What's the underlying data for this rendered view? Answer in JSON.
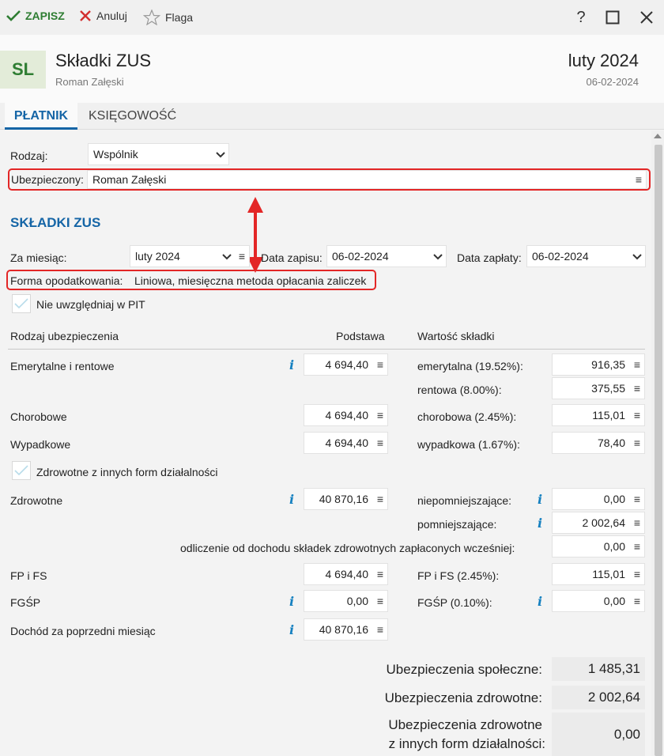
{
  "toolbar": {
    "save_label": "ZAPISZ",
    "cancel_label": "Anuluj",
    "flag_label": "Flaga",
    "help_glyph": "?",
    "maximize_glyph": "☐",
    "close_glyph": "✕"
  },
  "header": {
    "badge": "SL",
    "title": "Składki ZUS",
    "subtitle": "Roman Załęski",
    "period": "luty 2024",
    "period_date": "06-02-2024"
  },
  "tabs": {
    "active": "PŁATNIK",
    "inactive": "KSIĘGOWOŚĆ"
  },
  "payer": {
    "rodzaj_label": "Rodzaj:",
    "rodzaj_value": "Wspólnik",
    "ubezpieczony_label": "Ubezpieczony:",
    "ubezpieczony_value": "Roman Załęski"
  },
  "zus": {
    "section_title": "SKŁADKI ZUS",
    "za_miesiac_label": "Za miesiąc:",
    "za_miesiac_value": "luty 2024",
    "data_zapisu_label": "Data zapisu:",
    "data_zapisu_value": "06-02-2024",
    "data_zaplaty_label": "Data zapłaty:",
    "data_zaplaty_value": "06-02-2024",
    "forma_label": "Forma opodatkowania:",
    "forma_value": "Liniowa, miesięczna metoda opłacania zaliczek",
    "nie_uwzgledniaj_label": "Nie uwzględniaj w PIT",
    "col_rodzaj": "Rodzaj ubezpieczenia",
    "col_podstawa": "Podstawa",
    "col_wartosc": "Wartość składki"
  },
  "rows": {
    "emerytalne": {
      "label": "Emerytalne i rentowe",
      "podstawa": "4 694,40"
    },
    "emerytalna": {
      "label": "emerytalna (19.52%):",
      "value": "916,35"
    },
    "rentowa": {
      "label": "rentowa (8.00%):",
      "value": "375,55"
    },
    "chorobowe": {
      "label": "Chorobowe",
      "podstawa": "4 694,40"
    },
    "chorobowa": {
      "label": "chorobowa (2.45%):",
      "value": "115,01"
    },
    "wypadkowe": {
      "label": "Wypadkowe",
      "podstawa": "4 694,40"
    },
    "wypadkowa": {
      "label": "wypadkowa (1.67%):",
      "value": "78,40"
    },
    "zdrowotne_inne_label": "Zdrowotne z innych form działalności",
    "zdrowotne": {
      "label": "Zdrowotne",
      "podstawa": "40 870,16"
    },
    "niepomniejszajace": {
      "label": "niepomniejszające:",
      "value": "0,00"
    },
    "pomniejszajace": {
      "label": "pomniejszające:",
      "value": "2 002,64"
    },
    "odliczenie": {
      "label": "odliczenie od dochodu składek zdrowotnych zapłaconych wcześniej:",
      "value": "0,00"
    },
    "fpfs": {
      "label": "FP i FS",
      "podstawa": "4 694,40",
      "rate_label": "FP i FS (2.45%):",
      "value": "115,01"
    },
    "fgsp": {
      "label": "FGŚP",
      "podstawa": "0,00",
      "rate_label": "FGŚP (0.10%):",
      "value": "0,00"
    },
    "dochod": {
      "label": "Dochód za poprzedni miesiąc",
      "podstawa": "40 870,16"
    }
  },
  "summary": {
    "spoleczne_label": "Ubezpieczenia społeczne:",
    "spoleczne_value": "1 485,31",
    "zdrowotne_label": "Ubezpieczenia zdrowotne:",
    "zdrowotne_value": "2 002,64",
    "zdrowotne_inne_line1": "Ubezpieczenia zdrowotne",
    "zdrowotne_inne_line2": "z innych form działalności:",
    "zdrowotne_inne_value": "0,00"
  },
  "colors": {
    "accent": "#1565a6",
    "save_green": "#2e7d32",
    "highlight_red": "#e32626",
    "info_blue": "#1580c0"
  }
}
